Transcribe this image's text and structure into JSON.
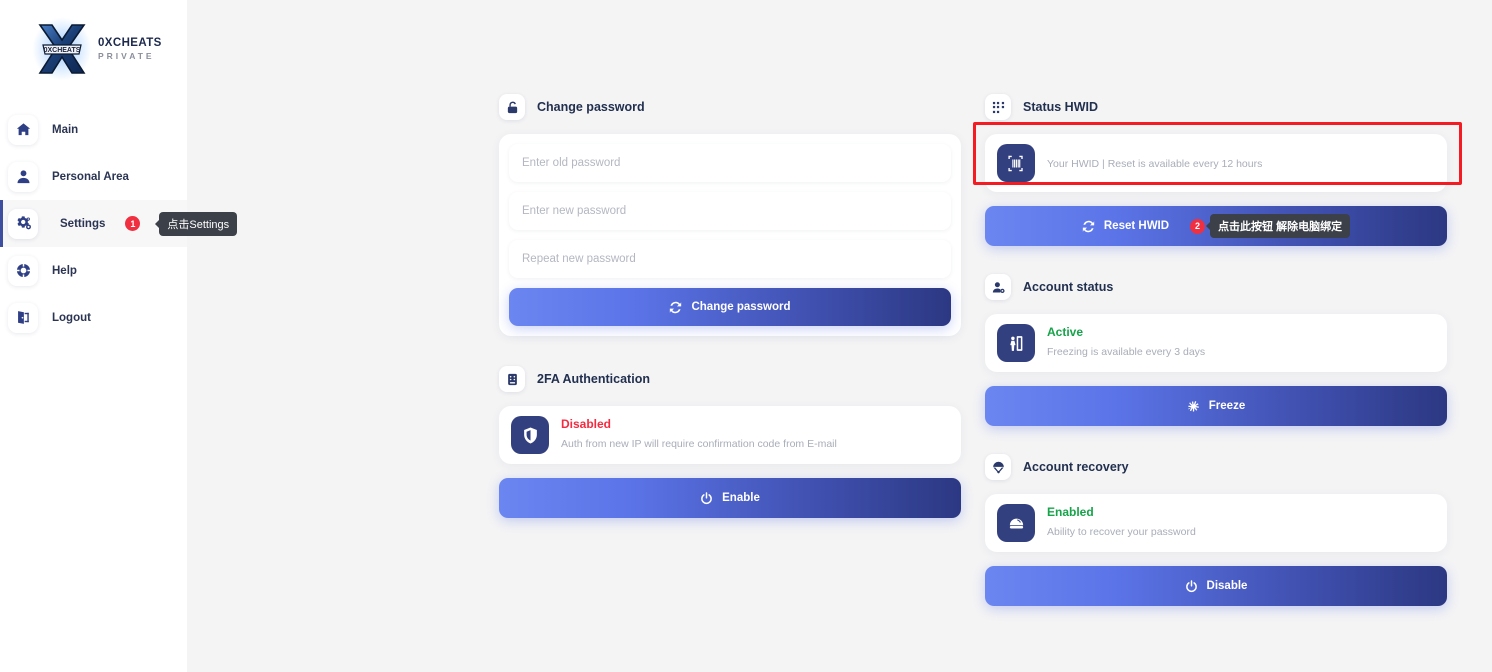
{
  "brand": {
    "name": "0XCHEATS",
    "sub": "PRIVATE",
    "logo_text": "0XCHEATS",
    "icon": "x-logo-icon"
  },
  "sidebar": {
    "items": [
      {
        "label": "Main",
        "icon": "home-icon"
      },
      {
        "label": "Personal Area",
        "icon": "user-icon"
      },
      {
        "label": "Settings",
        "icon": "gears-icon",
        "active": true,
        "badge": "1",
        "tooltip": "点击Settings"
      },
      {
        "label": "Help",
        "icon": "lifebuoy-icon"
      },
      {
        "label": "Logout",
        "icon": "logout-door-icon"
      }
    ]
  },
  "change_password": {
    "title": "Change password",
    "icon": "unlock-icon",
    "fields": [
      {
        "placeholder": "Enter old password"
      },
      {
        "placeholder": "Enter new password"
      },
      {
        "placeholder": "Repeat new password"
      }
    ],
    "submit_label": "Change password",
    "submit_icon": "refresh-icon"
  },
  "twofa": {
    "title": "2FA Authentication",
    "icon": "lock-keypad-icon",
    "status": "Disabled",
    "status_color": "#f42b40",
    "description": "Auth from new IP will require confirmation code from E-mail",
    "status_icon": "shield-icon",
    "button_label": "Enable",
    "button_icon": "power-icon"
  },
  "hwid": {
    "title": "Status HWID",
    "icon": "qr-code-icon",
    "value_masked": "",
    "description": "Your HWID | Reset is available every 12 hours",
    "value_icon": "barcode-icon",
    "button_label": "Reset HWID",
    "button_icon": "refresh-icon",
    "badge": "2",
    "tooltip": "点击此按钮 解除电脑绑定",
    "highlight_color": "#f41b22"
  },
  "account_status": {
    "title": "Account status",
    "icon": "user-gear-icon",
    "status": "Active",
    "status_color": "#17a34a",
    "description": "Freezing is available every 3 days",
    "status_icon": "freeze-building-icon",
    "button_label": "Freeze",
    "button_icon": "snowflake-icon"
  },
  "account_recovery": {
    "title": "Account recovery",
    "icon": "parachute-icon",
    "status": "Enabled",
    "status_color": "#17a34a",
    "description": "Ability to recover your password",
    "status_icon": "life-ring-icon",
    "button_label": "Disable",
    "button_icon": "power-icon"
  },
  "colors": {
    "accent_light": "#6b86f0",
    "accent_dark": "#2c3882",
    "navy": "#33407f",
    "bg": "#f4f4f5"
  }
}
